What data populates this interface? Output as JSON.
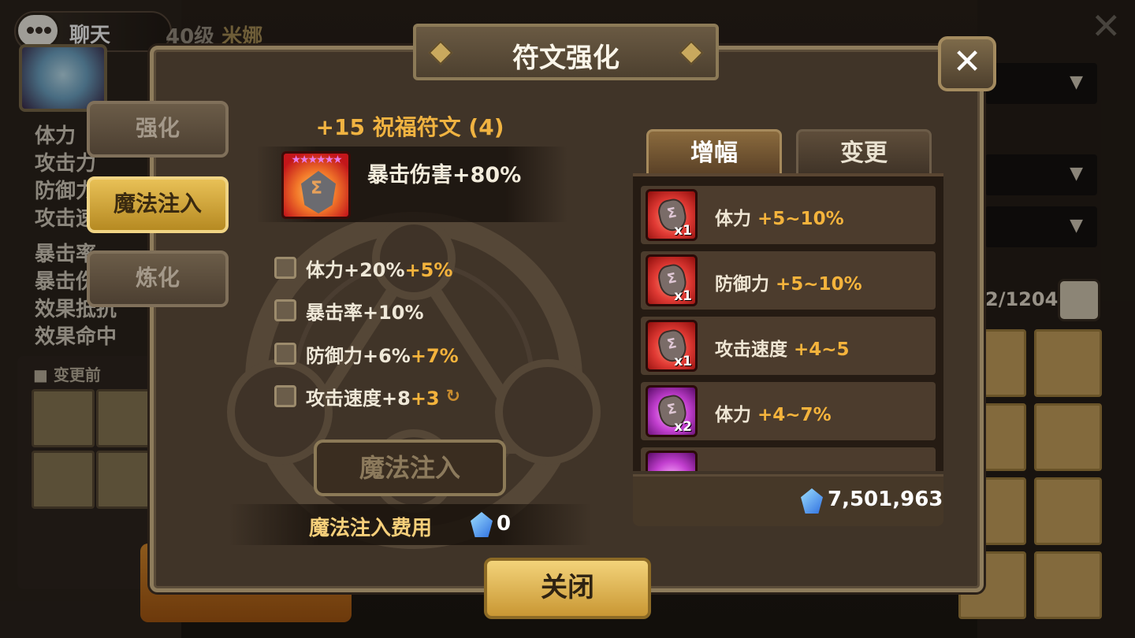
{
  "background": {
    "chat_label": "聊天",
    "hero_level": "40级",
    "hero_name": "米娜",
    "stats": [
      "体力",
      "攻击力",
      "防御力",
      "攻击速度",
      "暴击率",
      "暴击伤害",
      "效果抵抗",
      "效果命中"
    ],
    "before_change_label": "变更前",
    "rune_count": "2/1204"
  },
  "dialog": {
    "title": "符文强化",
    "close_symbol": "✕",
    "side_tabs": [
      {
        "label": "强化",
        "active": false
      },
      {
        "label": "魔法注入",
        "active": true
      },
      {
        "label": "炼化",
        "active": false
      }
    ],
    "rune": {
      "title": "+15 祝福符文 (4)",
      "stars": "★★★★★★",
      "main_stat": "暴击伤害+80%",
      "sub_stats": [
        {
          "label": "体力+20%",
          "bonus": "+5%",
          "reroll": ""
        },
        {
          "label": "暴击率+10%",
          "bonus": "",
          "reroll": ""
        },
        {
          "label": "防御力+6%",
          "bonus": "+7%",
          "reroll": ""
        },
        {
          "label": "攻击速度+8",
          "bonus": "+3",
          "reroll": "↻"
        }
      ]
    },
    "action_button": "魔法注入",
    "cost_label": "魔法注入费用",
    "cost_value": "0",
    "tabs": [
      {
        "label": "增幅",
        "active": true
      },
      {
        "label": "变更",
        "active": false
      }
    ],
    "items": [
      {
        "name": "体力",
        "range": "+5~10%",
        "qty": "x1",
        "color": "red"
      },
      {
        "name": "防御力",
        "range": "+5~10%",
        "qty": "x1",
        "color": "red"
      },
      {
        "name": "攻击速度",
        "range": "+4~5",
        "qty": "x1",
        "color": "red"
      },
      {
        "name": "体力",
        "range": "+4~7%",
        "qty": "x2",
        "color": "purple"
      }
    ],
    "crystal_total": "7,501,963",
    "close_button": "关闭"
  },
  "colors": {
    "accent_gold": "#f4b33c",
    "active_tab": "#e8c056",
    "panel_brown": "#403428"
  }
}
